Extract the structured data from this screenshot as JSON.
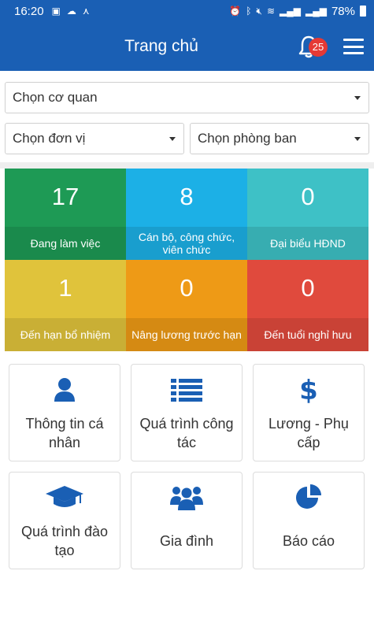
{
  "status_bar": {
    "time": "16:20",
    "battery": "78%"
  },
  "header": {
    "title": "Trang chủ",
    "notification_count": "25"
  },
  "filters": {
    "agency": "Chọn cơ quan",
    "unit": "Chọn đơn vị",
    "department": "Chọn phòng ban"
  },
  "stats": [
    {
      "value": "17",
      "label": "Đang làm việc",
      "color": "#1e9a55"
    },
    {
      "value": "8",
      "label": "Cán bộ, công chức, viên chức",
      "color": "#1cb0e6"
    },
    {
      "value": "0",
      "label": "Đại biểu HĐND",
      "color": "#3ec1c6"
    },
    {
      "value": "1",
      "label": "Đến hạn bổ nhiệm",
      "color": "#e0c33b"
    },
    {
      "value": "0",
      "label": "Nâng lương trước hạn",
      "color": "#ee9a16"
    },
    {
      "value": "0",
      "label": "Đến tuổi nghỉ hưu",
      "color": "#e04a3d"
    }
  ],
  "menu": [
    {
      "label": "Thông tin cá nhân",
      "icon": "user-icon"
    },
    {
      "label": "Quá trình công tác",
      "icon": "list-icon"
    },
    {
      "label": "Lương - Phụ cấp",
      "icon": "dollar-icon"
    },
    {
      "label": "Quá trình đào tạo",
      "icon": "graduation-cap-icon"
    },
    {
      "label": "Gia đình",
      "icon": "users-icon"
    },
    {
      "label": "Báo cáo",
      "icon": "pie-chart-icon"
    }
  ],
  "colors": {
    "primary": "#1a5fb4",
    "badge": "#e53935",
    "icon": "#1a5fb4"
  }
}
